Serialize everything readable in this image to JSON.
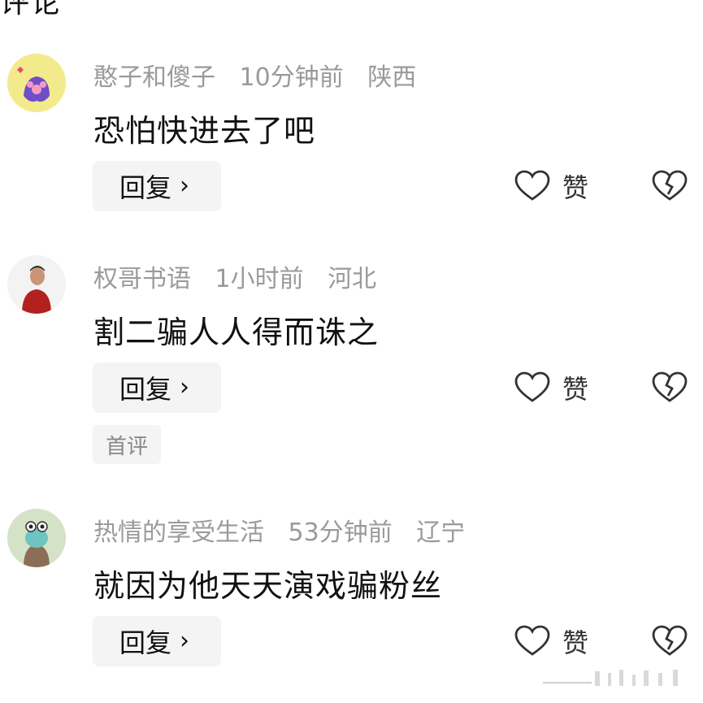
{
  "header": {
    "title_fragment": "评论"
  },
  "comments": [
    {
      "username": "憨子和傻子",
      "time": "10分钟前",
      "location": "陕西",
      "text": "恐怕快进去了吧",
      "reply_label": "回复",
      "like_label": "赞",
      "badge": ""
    },
    {
      "username": "权哥书语",
      "time": "1小时前",
      "location": "河北",
      "text": "割二骗人人得而诛之",
      "reply_label": "回复",
      "like_label": "赞",
      "badge": "首评"
    },
    {
      "username": "热情的享受生活",
      "time": "53分钟前",
      "location": "辽宁",
      "text": "就因为他天天演戏骗粉丝",
      "reply_label": "回复",
      "like_label": "赞",
      "badge": ""
    }
  ],
  "icons": {
    "reply_chevron": "chevron-right-icon",
    "like": "heart-outline-icon",
    "dislike": "broken-heart-icon"
  },
  "colors": {
    "meta_text": "#9a9a9a",
    "button_bg": "#f4f4f4",
    "text": "#111111"
  }
}
